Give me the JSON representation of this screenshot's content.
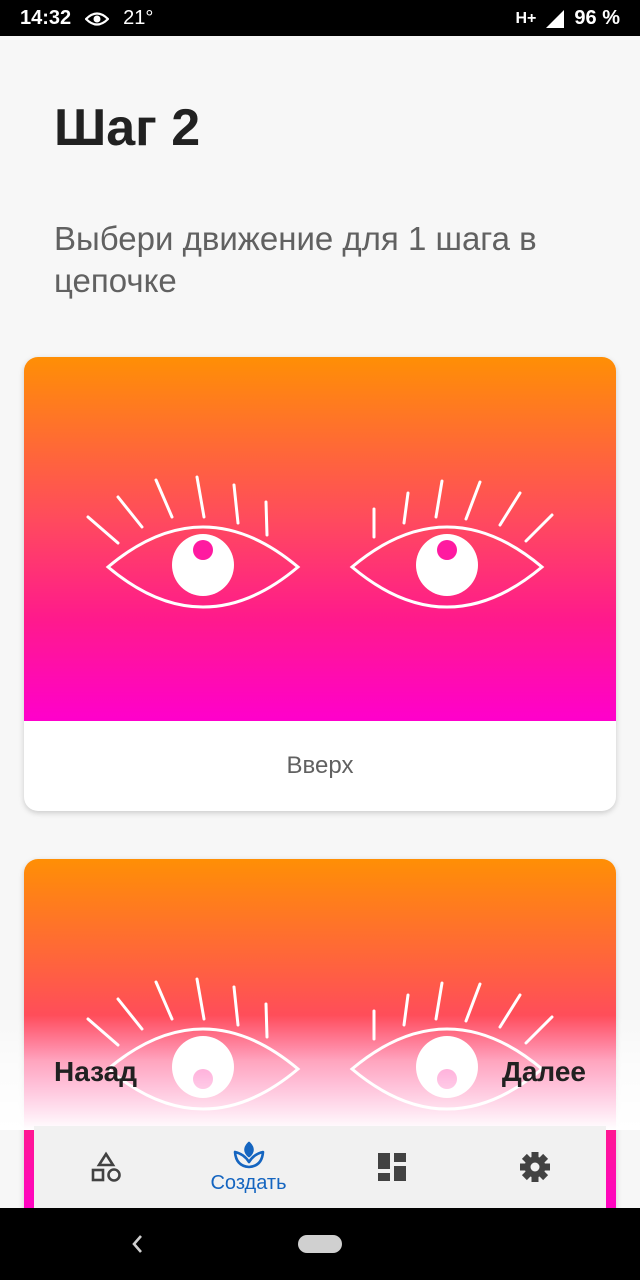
{
  "status_bar": {
    "time": "14:32",
    "temperature": "21°",
    "network": "H+",
    "battery": "96 %",
    "icons": [
      "eye-icon",
      "signal-icon"
    ]
  },
  "header": {
    "title": "Шаг 2",
    "subtitle": "Выбери движение для 1 шага в цепочке"
  },
  "cards": [
    {
      "label": "Вверх",
      "illustration": "eyes-looking-up",
      "pupil_color": "#ff1aa0"
    },
    {
      "label": "",
      "illustration": "eyes-looking-down",
      "pupil_color": "#ff3da6"
    }
  ],
  "gradient": {
    "top": "#ff8f05",
    "bottom": "#ff00cc"
  },
  "footer_nav": {
    "back_label": "Назад",
    "next_label": "Далее"
  },
  "tab_bar": {
    "accent": "#1565c0",
    "tabs": [
      {
        "icon": "shapes-icon",
        "label": ""
      },
      {
        "icon": "sprout-icon",
        "label": "Создать",
        "active": true
      },
      {
        "icon": "dashboard-icon",
        "label": ""
      },
      {
        "icon": "gear-icon",
        "label": ""
      }
    ]
  },
  "system_nav": {
    "icons": [
      "back-chevron-icon",
      "home-pill-icon"
    ]
  }
}
